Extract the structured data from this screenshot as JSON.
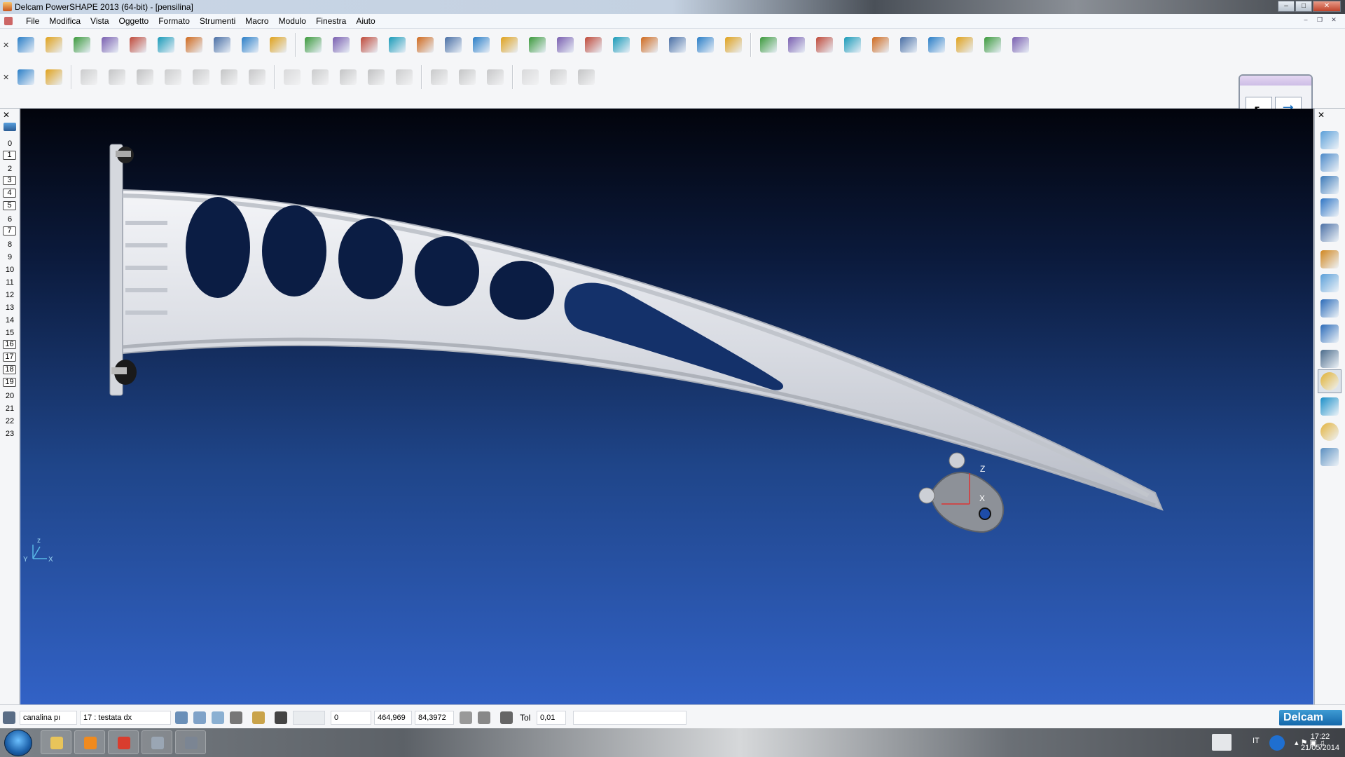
{
  "window": {
    "title": "Delcam PowerSHAPE 2013 (64-bit) - [pensilina]"
  },
  "menu": {
    "items": [
      "File",
      "Modifica",
      "Vista",
      "Oggetto",
      "Formato",
      "Strumenti",
      "Macro",
      "Modulo",
      "Finestra",
      "Aiuto"
    ]
  },
  "toolbar1": {
    "icons": [
      "new-file-icon",
      "open-folder-icon",
      "import-icon",
      "save-icon",
      "print-icon",
      "cut-icon",
      "copy-icon",
      "paste-icon",
      "brush-icon",
      "delete-icon",
      "undo-icon",
      "redo-icon",
      "edit-icon",
      "workplane-icon",
      "axes-icon",
      "line-icon",
      "circle-icon",
      "curve-icon",
      "text-icon",
      "surface-icon",
      "solid-icon",
      "plane-icon",
      "gear-icon",
      "wand-icon",
      "workplane-align-icon",
      "x-axis-icon",
      "export-icon",
      "move-icon",
      "blocks-icon",
      "cube-icon",
      "yellow-cube-icon",
      "cube-array-icon",
      "measure-icon",
      "arrows-icon",
      "ball-icon",
      "triangle-icon"
    ]
  },
  "toolbar2": {
    "icons": [
      "tree-icon",
      "pin-icon",
      "solid-box-icon",
      "solid-extrude-icon",
      "solid-revolve-icon",
      "solid-cone-icon",
      "solid-shape-icon",
      "solid-square-icon",
      "solid-cut-icon",
      "solid-feature1-icon",
      "solid-feature2-icon",
      "solid-add-icon",
      "solid-subtract-icon",
      "solid-plus-icon",
      "layer1-icon",
      "layer2-icon",
      "layer3-icon",
      "gear2-icon",
      "blocks2-icon",
      "arrow2-icon"
    ]
  },
  "select_panel": {
    "items": [
      "pointer-icon",
      "transform-icon"
    ]
  },
  "levels": [
    {
      "n": "0",
      "boxed": false
    },
    {
      "n": "1",
      "boxed": true
    },
    {
      "n": "2",
      "boxed": false
    },
    {
      "n": "3",
      "boxed": true
    },
    {
      "n": "4",
      "boxed": true
    },
    {
      "n": "5",
      "boxed": true
    },
    {
      "n": "6",
      "boxed": false
    },
    {
      "n": "7",
      "boxed": true
    },
    {
      "n": "8",
      "boxed": false
    },
    {
      "n": "9",
      "boxed": false
    },
    {
      "n": "10",
      "boxed": false
    },
    {
      "n": "11",
      "boxed": false
    },
    {
      "n": "12",
      "boxed": false
    },
    {
      "n": "13",
      "boxed": false
    },
    {
      "n": "14",
      "boxed": false
    },
    {
      "n": "15",
      "boxed": false
    },
    {
      "n": "16",
      "boxed": true
    },
    {
      "n": "17",
      "boxed": true
    },
    {
      "n": "18",
      "boxed": true
    },
    {
      "n": "19",
      "boxed": true
    },
    {
      "n": "20",
      "boxed": false
    },
    {
      "n": "21",
      "boxed": false
    },
    {
      "n": "22",
      "boxed": false
    },
    {
      "n": "23",
      "boxed": false
    }
  ],
  "right_panel": {
    "icons": [
      "view-iso1-icon",
      "view-iso2-icon",
      "view-iso3-icon",
      "view-cube-icon",
      "view-zoom-icon",
      "view-rotate-icon",
      "view-spin-icon",
      "zoom-fit-icon",
      "zoom-box-icon",
      "wireframe-icon",
      "shaded-icon",
      "plane-view-icon",
      "sphere-icon",
      "lamp-icon"
    ]
  },
  "viewport": {
    "axis_labels": {
      "z": "Z",
      "x": "X",
      "y": "Y",
      "mini_z": "z",
      "mini_x": "X",
      "mini_y": "Y"
    }
  },
  "status": {
    "workplane": "canalina pı",
    "level": "17 : testata dx",
    "field_blank": "",
    "value1": "0",
    "coord_x": "464,969",
    "coord_y": "84,3972",
    "tol_label": "Tol",
    "tol_value": "0,01",
    "brand": "Delcam"
  },
  "taskbar": {
    "apps": [
      "explorer-icon",
      "media-player-icon",
      "chrome-icon",
      "powershape-icon",
      "powershape2-icon"
    ],
    "lang": "IT",
    "time": "17:22",
    "date": "21/05/2014"
  }
}
